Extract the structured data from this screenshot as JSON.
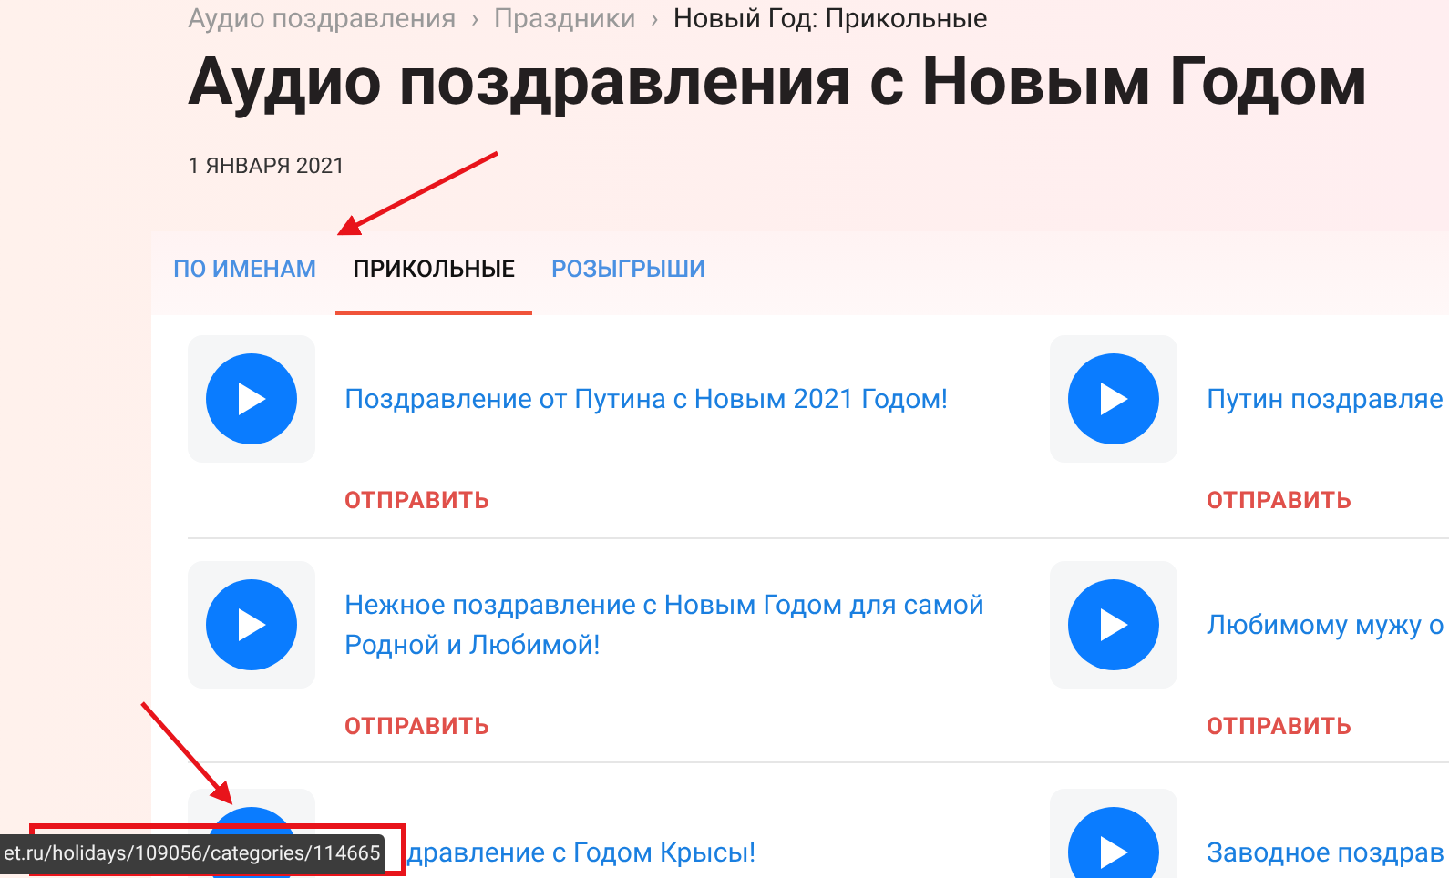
{
  "breadcrumbs": [
    {
      "label": "Аудио поздравления"
    },
    {
      "label": "Праздники"
    },
    {
      "label": "Новый Год: Прикольные"
    }
  ],
  "breadcrumb_separator": "›",
  "title": "Аудио поздравления с Новым Годом",
  "date": "1 ЯНВАРЯ 2021",
  "tabs": [
    {
      "label": "ПО ИМЕНАМ",
      "selected": false
    },
    {
      "label": "ПРИКОЛЬНЫЕ",
      "selected": true
    },
    {
      "label": "РОЗЫГРЫШИ",
      "selected": false
    }
  ],
  "items": [
    {
      "title": "Поздравление от Путина с Новым 2021 Годом!",
      "action": "ОТПРАВИТЬ"
    },
    {
      "title": "Путин поздравляе",
      "action": "ОТПРАВИТЬ"
    },
    {
      "title": "Нежное поздравление с Новым Годом для самой Родной и Любимой!",
      "action": "ОТПРАВИТЬ"
    },
    {
      "title": "Любимому мужу о",
      "action": "ОТПРАВИТЬ"
    },
    {
      "title": "дравление с Годом Крысы!"
    },
    {
      "title": "Заводное поздрав"
    }
  ],
  "status_bar": {
    "url": "et.ru/holidays/109056/categories/114665"
  }
}
